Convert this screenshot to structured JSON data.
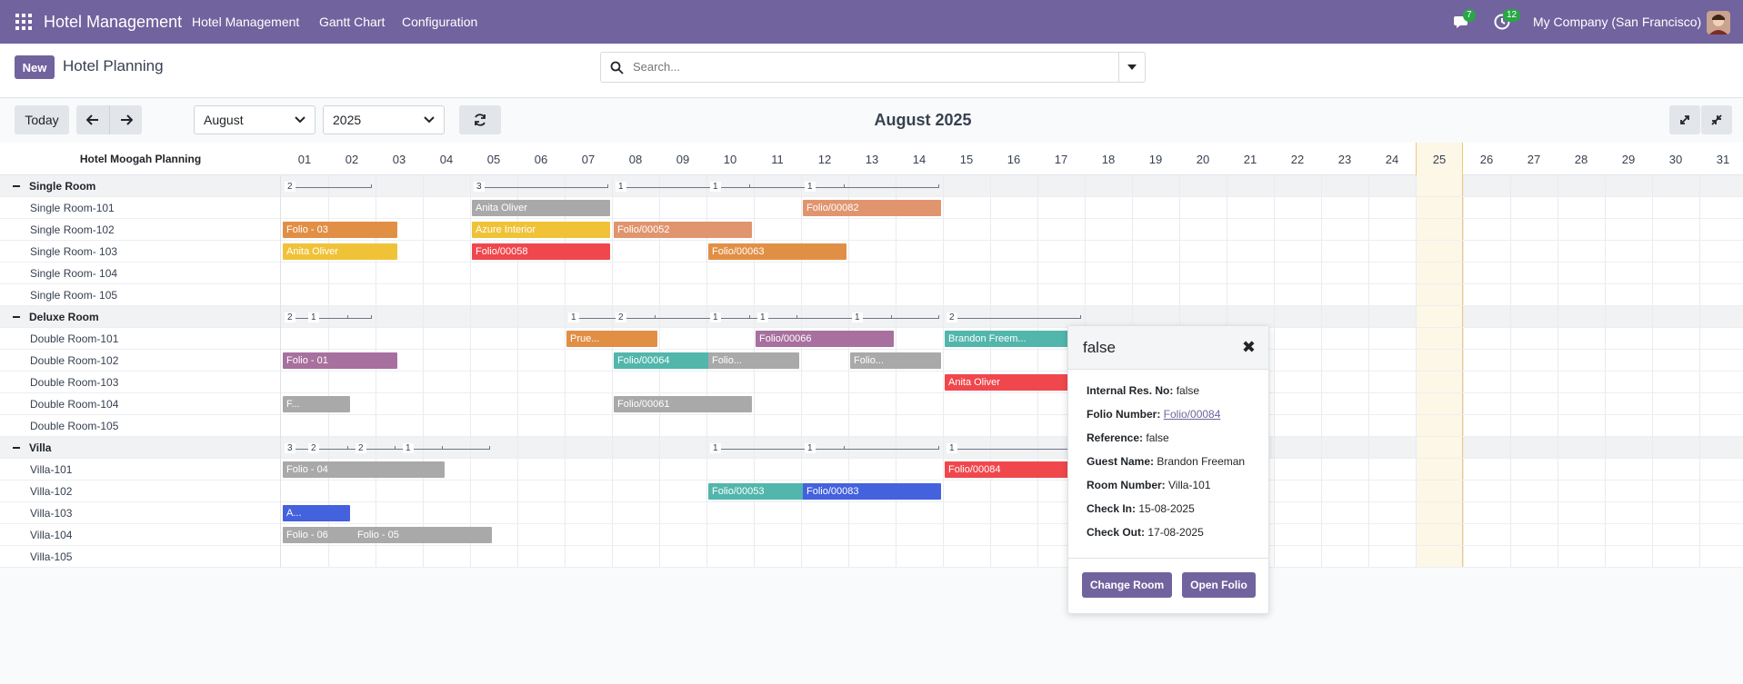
{
  "navbar": {
    "brand": "Hotel Management",
    "menu": [
      "Hotel Management",
      "Gantt Chart",
      "Configuration"
    ],
    "messages_count": "7",
    "activities_count": "12",
    "company": "My Company (San Francisco)"
  },
  "control_panel": {
    "new_label": "New",
    "title": "Hotel Planning",
    "search_placeholder": "Search..."
  },
  "toolbar": {
    "today_label": "Today",
    "month_value": "August",
    "year_value": "2025",
    "period_title": "August 2025"
  },
  "grid": {
    "corner_label": "Hotel Moogah Planning",
    "days": [
      "01",
      "02",
      "03",
      "04",
      "05",
      "06",
      "07",
      "08",
      "09",
      "10",
      "11",
      "12",
      "13",
      "14",
      "15",
      "16",
      "17",
      "18",
      "19",
      "20",
      "21",
      "22",
      "23",
      "24",
      "25",
      "26",
      "27",
      "28",
      "29",
      "30",
      "31"
    ],
    "today_day": 25,
    "rows": [
      {
        "kind": "group",
        "label": "Single Room"
      },
      {
        "kind": "room",
        "label": "Single Room-101"
      },
      {
        "kind": "room",
        "label": "Single Room-102"
      },
      {
        "kind": "room",
        "label": "Single Room- 103"
      },
      {
        "kind": "room",
        "label": "Single Room- 104"
      },
      {
        "kind": "room",
        "label": "Single Room- 105"
      },
      {
        "kind": "group",
        "label": "Deluxe Room"
      },
      {
        "kind": "room",
        "label": "Double Room-101"
      },
      {
        "kind": "room",
        "label": "Double Room-102"
      },
      {
        "kind": "room",
        "label": "Double Room-103"
      },
      {
        "kind": "room",
        "label": "Double Room-104"
      },
      {
        "kind": "room",
        "label": "Double Room-105"
      },
      {
        "kind": "group",
        "label": "Villa"
      },
      {
        "kind": "room",
        "label": "Villa-101"
      },
      {
        "kind": "room",
        "label": "Villa-102"
      },
      {
        "kind": "room",
        "label": "Villa-103"
      },
      {
        "kind": "room",
        "label": "Villa-104"
      },
      {
        "kind": "room",
        "label": "Villa-105"
      }
    ],
    "consolidations": [
      {
        "row": 0,
        "start": 1,
        "end": 2,
        "count": "2"
      },
      {
        "row": 0,
        "start": 5,
        "end": 7,
        "count": "3"
      },
      {
        "row": 0,
        "start": 8,
        "end": 10,
        "count": "1"
      },
      {
        "row": 0,
        "start": 10,
        "end": 12,
        "count": "1"
      },
      {
        "row": 0,
        "start": 12,
        "end": 14,
        "count": "1"
      },
      {
        "row": 6,
        "start": 1,
        "end": 1.5,
        "count": "2"
      },
      {
        "row": 6,
        "start": 1.5,
        "end": 2,
        "count": "1"
      },
      {
        "row": 6,
        "start": 7,
        "end": 8,
        "count": "1"
      },
      {
        "row": 6,
        "start": 8,
        "end": 10,
        "count": "2"
      },
      {
        "row": 6,
        "start": 10,
        "end": 11,
        "count": "1"
      },
      {
        "row": 6,
        "start": 11,
        "end": 13,
        "count": "1"
      },
      {
        "row": 6,
        "start": 13,
        "end": 14,
        "count": "1"
      },
      {
        "row": 6,
        "start": 15,
        "end": 17,
        "count": "2"
      },
      {
        "row": 12,
        "start": 1,
        "end": 1.5,
        "count": "3"
      },
      {
        "row": 12,
        "start": 1.5,
        "end": 2.5,
        "count": "2"
      },
      {
        "row": 12,
        "start": 2.5,
        "end": 3.5,
        "count": "2"
      },
      {
        "row": 12,
        "start": 3.5,
        "end": 4.5,
        "count": "1"
      },
      {
        "row": 12,
        "start": 10,
        "end": 12,
        "count": "1"
      },
      {
        "row": 12,
        "start": 12,
        "end": 14,
        "count": "1"
      },
      {
        "row": 12,
        "start": 15,
        "end": 17,
        "count": "1"
      }
    ],
    "pills": [
      {
        "row": 1,
        "start": 5,
        "end": 7,
        "text": "Anita Oliver",
        "color": "#a9a9a9"
      },
      {
        "row": 1,
        "start": 12,
        "end": 14,
        "text": "Folio/00082",
        "color": "#e0956f"
      },
      {
        "row": 2,
        "start": 1,
        "end": 2.5,
        "text": "Folio - 03",
        "color": "#e28f46"
      },
      {
        "row": 2,
        "start": 5,
        "end": 7,
        "text": "Azure Interior",
        "color": "#f0c238"
      },
      {
        "row": 2,
        "start": 8,
        "end": 10,
        "text": "Folio/00052",
        "color": "#e0956f"
      },
      {
        "row": 3,
        "start": 1,
        "end": 2.5,
        "text": "Anita Oliver",
        "color": "#f0c238"
      },
      {
        "row": 3,
        "start": 5,
        "end": 7,
        "text": "Folio/00058",
        "color": "#f0474d"
      },
      {
        "row": 3,
        "start": 10,
        "end": 12,
        "text": "Folio/00063",
        "color": "#e28f46"
      },
      {
        "row": 7,
        "start": 7,
        "end": 8,
        "text": "Prue...",
        "color": "#e28f46"
      },
      {
        "row": 7,
        "start": 11,
        "end": 13,
        "text": "Folio/00066",
        "color": "#a8709e"
      },
      {
        "row": 7,
        "start": 15,
        "end": 17,
        "text": "Brandon Freem...",
        "color": "#52b6ac"
      },
      {
        "row": 8,
        "start": 1,
        "end": 2.5,
        "text": "Folio - 01",
        "color": "#a8709e"
      },
      {
        "row": 8,
        "start": 8,
        "end": 10,
        "text": "Folio/00064",
        "color": "#52b6ac"
      },
      {
        "row": 8,
        "start": 10,
        "end": 11,
        "text": "Folio...",
        "color": "#a9a9a9"
      },
      {
        "row": 8,
        "start": 13,
        "end": 14,
        "text": "Folio...",
        "color": "#a9a9a9"
      },
      {
        "row": 9,
        "start": 15,
        "end": 17,
        "text": "Anita Oliver",
        "color": "#f0474d"
      },
      {
        "row": 10,
        "start": 1,
        "end": 1.5,
        "text": "F...",
        "color": "#a9a9a9"
      },
      {
        "row": 10,
        "start": 8,
        "end": 10,
        "text": "Folio/00061",
        "color": "#a9a9a9"
      },
      {
        "row": 13,
        "start": 1,
        "end": 3.5,
        "text": "Folio - 04",
        "color": "#a9a9a9"
      },
      {
        "row": 13,
        "start": 15,
        "end": 17,
        "text": "Folio/00084",
        "color": "#f0474d"
      },
      {
        "row": 14,
        "start": 10,
        "end": 12,
        "text": "Folio/00053",
        "color": "#52b6ac"
      },
      {
        "row": 14,
        "start": 12,
        "end": 14,
        "text": "Folio/00083",
        "color": "#4461de"
      },
      {
        "row": 15,
        "start": 1,
        "end": 1.5,
        "text": "A...",
        "color": "#4461de"
      },
      {
        "row": 16,
        "start": 1,
        "end": 2.5,
        "text": "Folio - 06",
        "color": "#a9a9a9"
      },
      {
        "row": 16,
        "start": 2.5,
        "end": 4.5,
        "text": "Folio - 05",
        "color": "#a9a9a9"
      }
    ]
  },
  "popover": {
    "title": "false",
    "fields": [
      {
        "label": "Internal Res. No:",
        "value": "false"
      },
      {
        "label": "Folio Number:",
        "value": "Folio/00084",
        "link": true
      },
      {
        "label": "Reference:",
        "value": "false"
      },
      {
        "label": "Guest Name:",
        "value": "Brandon Freeman"
      },
      {
        "label": "Room Number:",
        "value": "Villa-101"
      },
      {
        "label": "Check In:",
        "value": "15-08-2025"
      },
      {
        "label": "Check Out:",
        "value": "17-08-2025"
      }
    ],
    "change_room_label": "Change Room",
    "open_folio_label": "Open Folio"
  }
}
